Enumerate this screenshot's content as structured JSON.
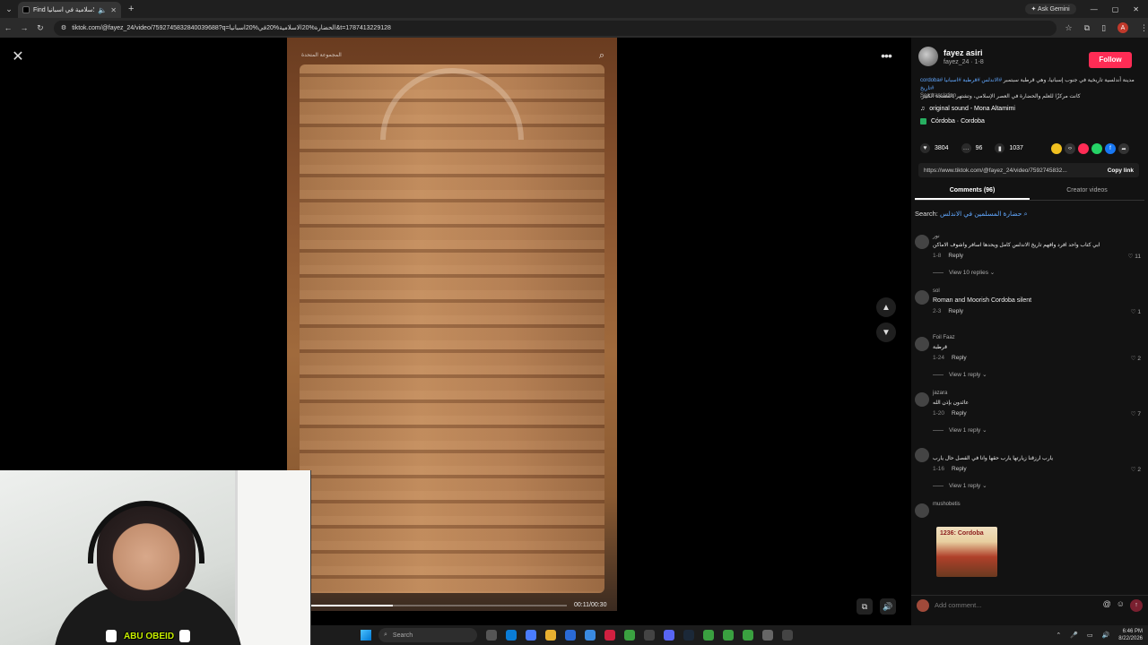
{
  "browser": {
    "tab_title": "Find الحضارة الاسلامية في اسبانيا",
    "url": "tiktok.com/@fayez_24/video/7592745832840039688?q=الحضارة%20الاسلامية%20في%20اسبانيا&t=1787413229128",
    "ask_gemini": "Ask Gemini",
    "profile_initial": "A"
  },
  "video": {
    "header_text": "المجموعة المتحدة",
    "time": "00:11/00:30",
    "progress_fraction": 0.32
  },
  "panel": {
    "author_name": "fayez asiri",
    "author_sub": "fayez_24 · 1-8",
    "follow_label": "Follow",
    "description": "مدينة أندلسية تاريخية في جنوب إسبانيا، وهي قرطبة سبتمبر",
    "hashtags": "#الاندلس #قرطبة #اسبانيا #cordoba #تاريخ",
    "description_line2": "كانت مركزًا للعلم والحضارة في العصر الإسلامي، وتشتهر بالمسجد الكبير.",
    "see_translation": "See translation",
    "sound": "original sound - Mona Altamimi",
    "location": "Córdoba · Cordoba",
    "likes": "3804",
    "comments_count": "96",
    "saves": "1037",
    "link": "https://www.tiktok.com/@fayez_24/video/7592745832...",
    "copy_link": "Copy link",
    "tab_comments": "Comments (96)",
    "tab_creator": "Creator videos",
    "search_label": "Search:",
    "search_query": "حضارة المسلمين في الاندلس"
  },
  "comments": [
    {
      "user": "نور",
      "text": "ابي كتاب واحد افرد وافهم تاريخ الاندلس كامل ويحدها اسافر واشوف الاماكن",
      "date": "1-8",
      "reply": "Reply",
      "likes": "11",
      "view_replies": "View 10 replies",
      "rtl": true
    },
    {
      "user": "sol",
      "text": "Roman and Moorish Cordoba silent",
      "date": "2-3",
      "reply": "Reply",
      "likes": "1",
      "view_replies": "",
      "rtl": false
    },
    {
      "user": "Foil Faaz",
      "text": "قرطبة",
      "date": "1-24",
      "reply": "Reply",
      "likes": "2",
      "view_replies": "View 1 reply",
      "rtl": true
    },
    {
      "user": "jazara",
      "text": "عائدون بإذن الله",
      "date": "1-20",
      "reply": "Reply",
      "likes": "7",
      "view_replies": "View 1 reply",
      "rtl": true
    },
    {
      "user": "",
      "text": "يارب ارزقنا زيارتها يارب حقها وانا في الفصل حال يارب",
      "date": "1-16",
      "reply": "Reply",
      "likes": "2",
      "view_replies": "View 1 reply",
      "rtl": true
    },
    {
      "user": "mushobetis",
      "text": "",
      "date": "",
      "reply": "",
      "likes": "",
      "view_replies": "",
      "rtl": false
    }
  ],
  "thumb_title": "1236: Cordoba",
  "add_comment_placeholder": "Add comment...",
  "webcam": {
    "streamer_name": "ABU OBEID"
  },
  "taskbar": {
    "search_placeholder": "Search",
    "time": "6:46 PM",
    "date": "8/22/2026"
  },
  "colors": {
    "follow": "#fe2c55",
    "link": "#62a8ff",
    "streamer_name": "#c8f000"
  }
}
